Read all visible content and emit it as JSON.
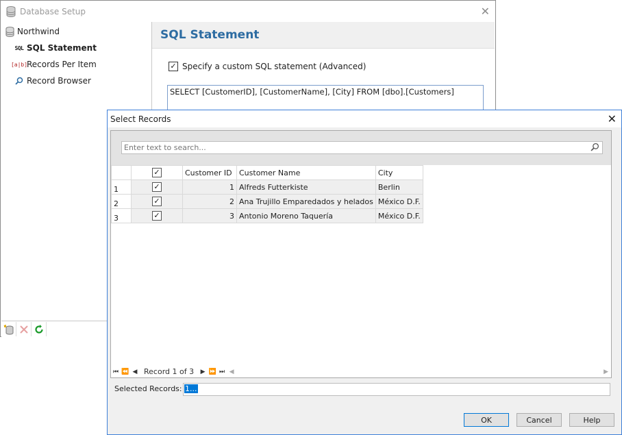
{
  "main_window": {
    "title": "Database Setup",
    "tree": {
      "root": "Northwind",
      "items": [
        {
          "label": "SQL Statement",
          "icon": "sql-icon",
          "selected": true
        },
        {
          "label": "Records Per Item",
          "icon": "ab-field-icon"
        },
        {
          "label": "Record Browser",
          "icon": "search-icon"
        }
      ]
    },
    "section_title": "SQL Statement",
    "custom_sql_checkbox": {
      "label": "Specify a custom SQL statement (Advanced)",
      "checked": true
    },
    "sql_text": "SELECT [CustomerID], [CustomerName], [City] FROM [dbo].[Customers]"
  },
  "dialog": {
    "title": "Select Records",
    "search_placeholder": "Enter text to search...",
    "columns": [
      "Customer ID",
      "Customer Name",
      "City"
    ],
    "rows": [
      {
        "n": "1",
        "checked": true,
        "id": "1",
        "name": "Alfreds Futterkiste",
        "city": "Berlin"
      },
      {
        "n": "2",
        "checked": true,
        "id": "2",
        "name": "Ana Trujillo Emparedados y helados",
        "city": "México D.F."
      },
      {
        "n": "3",
        "checked": true,
        "id": "3",
        "name": "Antonio Moreno Taquería",
        "city": "México D.F."
      }
    ],
    "navigator": "Record 1 of 3",
    "selected_records_label": "Selected Records:",
    "selected_records_value": "1...",
    "buttons": {
      "ok": "OK",
      "cancel": "Cancel",
      "help": "Help"
    }
  },
  "colors": {
    "accent": "#2d6ca2",
    "dialog_border": "#3d7fd8",
    "selection": "#0078d7"
  }
}
